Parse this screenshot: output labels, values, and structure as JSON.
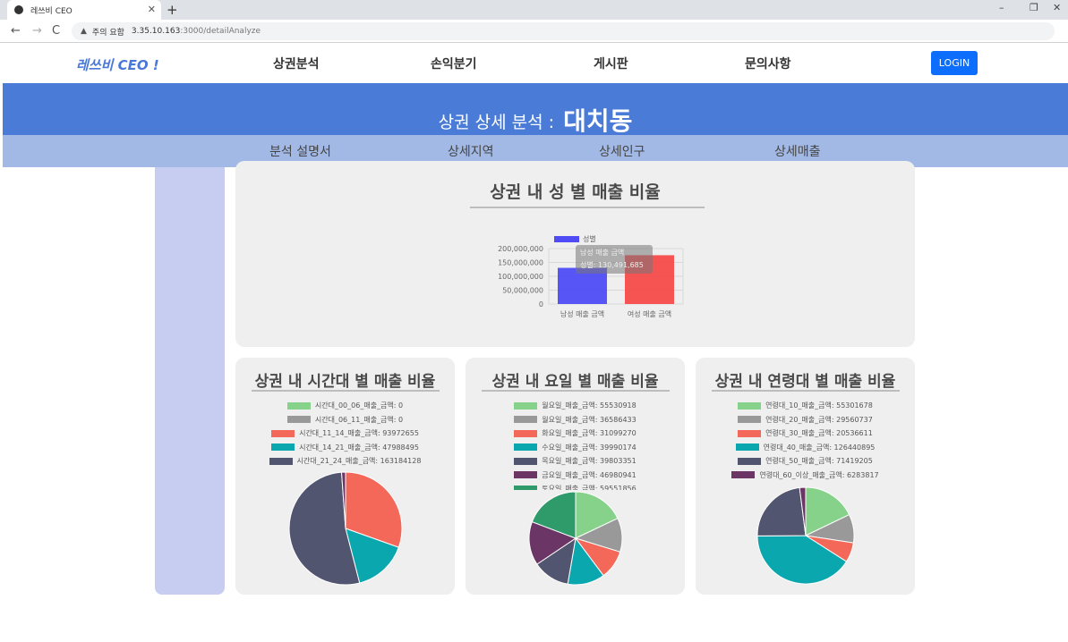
{
  "browser": {
    "tab_title": "레쓰비 CEO",
    "tab_close": "✕",
    "new_tab": "+",
    "security_warning": "주의 요함",
    "url_host": "3.35.10.163",
    "url_path": ":3000/detailAnalyze",
    "back": "←",
    "forward": "→",
    "reload": "C",
    "minimize": "–",
    "restore": "❐",
    "close": "✕"
  },
  "header": {
    "logo": "레쓰비 CEO !",
    "menu": [
      "상권분석",
      "손익분기",
      "게시판",
      "문의사항"
    ],
    "login": "LOGIN"
  },
  "banner": {
    "label": "상권 상세 분석 :",
    "area": "대치동"
  },
  "subnav": [
    "분석 설명서",
    "상세지역",
    "상세인구",
    "상세매출"
  ],
  "gender_panel": {
    "title": "상권 내 성 별 매출 비율",
    "chart_data": {
      "type": "bar",
      "title": "",
      "categories": [
        "남성 매출 금액",
        "여성 매출 금액"
      ],
      "series": [
        {
          "name": "성별",
          "values": [
            130491685,
            176000000
          ]
        }
      ],
      "colors": [
        "#4f4cf5",
        "#f54a4a"
      ],
      "ylim": [
        0,
        200000000
      ],
      "yticks": [
        "200,000,000",
        "150,000,000",
        "100,000,000",
        "50,000,000",
        "0"
      ],
      "grid": true,
      "legend": "top",
      "tooltip": {
        "title": "남성 매출 금액",
        "text": "성별: 130,491,685"
      }
    }
  },
  "time_panel": {
    "title": "상권 내 시간대 별 매출 비율",
    "chart_data": {
      "type": "pie",
      "legend": "top",
      "series": [
        {
          "name": "시간대_00_06_매출_금액",
          "value": 0,
          "color": "#86d28a"
        },
        {
          "name": "시간대_06_11_매출_금액",
          "value": 0,
          "color": "#999999"
        },
        {
          "name": "시간대_11_14_매출_금액",
          "value": 93972655,
          "color": "#f4685a"
        },
        {
          "name": "시간대_14_21_매출_금액",
          "value": 47988495,
          "color": "#0aa8ae"
        },
        {
          "name": "시간대_21_24_매출_금액",
          "value": 163184128,
          "color": "#52556f"
        }
      ],
      "extra_slices": [
        {
          "value": 3500000,
          "color": "#6b3565"
        }
      ]
    }
  },
  "weekday_panel": {
    "title": "상권 내 요일 별 매출 비율",
    "chart_data": {
      "type": "pie",
      "legend": "top",
      "series": [
        {
          "name": "월요일_매출_금액",
          "value": 55530918,
          "color": "#86d28a"
        },
        {
          "name": "월요일_매출_금액",
          "value": 36586433,
          "color": "#999999"
        },
        {
          "name": "화요일_매출_금액",
          "value": 31099270,
          "color": "#f4685a"
        },
        {
          "name": "수요일_매출_금액",
          "value": 39990174,
          "color": "#0aa8ae"
        },
        {
          "name": "목요일_매출_금액",
          "value": 39803351,
          "color": "#52556f"
        },
        {
          "name": "금요일_매출_금액",
          "value": 46980941,
          "color": "#6b3565"
        },
        {
          "name": "토요일_매출_금액",
          "value": 59551856,
          "color": "#2f9a6a"
        }
      ]
    }
  },
  "age_panel": {
    "title": "상권 내 연령대 별 매출 비율",
    "chart_data": {
      "type": "pie",
      "legend": "top",
      "series": [
        {
          "name": "연령대_10_매출_금액",
          "value": 55301678,
          "color": "#86d28a"
        },
        {
          "name": "연령대_20_매출_금액",
          "value": 29560737,
          "color": "#999999"
        },
        {
          "name": "연령대_30_매출_금액",
          "value": 20536611,
          "color": "#f4685a"
        },
        {
          "name": "연령대_40_매출_금액",
          "value": 126440895,
          "color": "#0aa8ae"
        },
        {
          "name": "연령대_50_매출_금액",
          "value": 71419205,
          "color": "#52556f"
        },
        {
          "name": "연령대_60_이상_매출_금액",
          "value": 6283817,
          "color": "#6b3565"
        }
      ]
    }
  }
}
